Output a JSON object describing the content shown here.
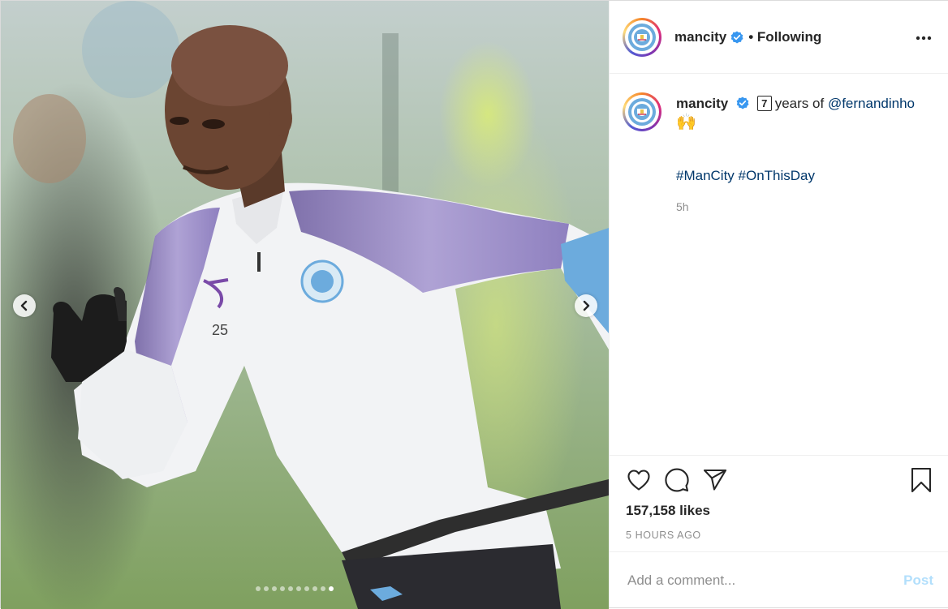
{
  "account": {
    "username": "mancity",
    "follow_status": "• Following",
    "verified": true
  },
  "caption": {
    "username": "mancity",
    "keycap": "7",
    "text_before_mention": "years of",
    "mention": "@fernandinho",
    "emoji": "🙌",
    "hashtags": "#ManCity #OnThisDay",
    "time": "5h"
  },
  "media": {
    "jersey_number": "25",
    "dot_count": 10,
    "active_dot": 9
  },
  "stats": {
    "likes": "157,158 likes",
    "age": "5 HOURS AGO"
  },
  "comment": {
    "placeholder": "Add a comment...",
    "post_label": "Post"
  },
  "icons": [
    "more-options-icon",
    "heart-icon",
    "comment-icon",
    "share-icon",
    "bookmark-icon",
    "chevron-left-icon",
    "chevron-right-icon",
    "verified-badge-icon"
  ],
  "colors": {
    "link": "#00376b",
    "post_button": "#b2dffc",
    "muted": "#8e8e8e",
    "city_blue": "#6cabdd"
  }
}
